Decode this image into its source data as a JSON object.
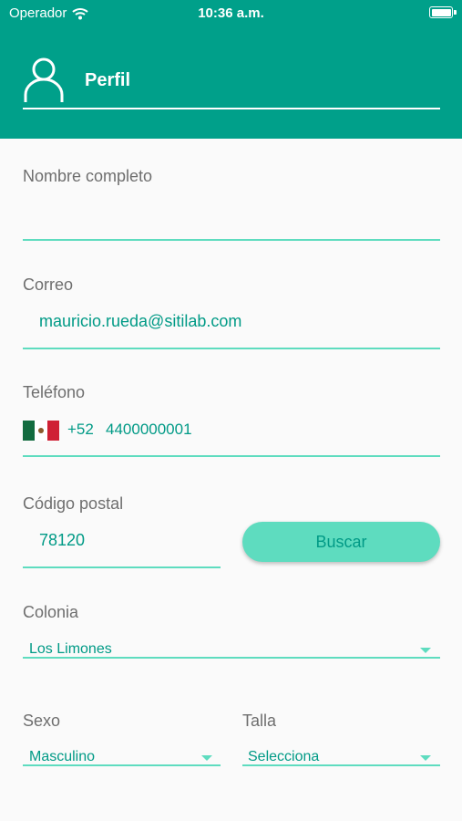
{
  "status_bar": {
    "carrier": "Operador",
    "time": "10:36 a.m."
  },
  "header": {
    "title": "Perfil",
    "icon": "user-icon"
  },
  "form": {
    "nombre": {
      "label": "Nombre completo",
      "value": ""
    },
    "correo": {
      "label": "Correo",
      "value": "mauricio.rueda@sitilab.com"
    },
    "telefono": {
      "label": "Teléfono",
      "country_code": "+52",
      "number": "4400000001",
      "flag_icon": "mexico-flag-icon"
    },
    "codigo_postal": {
      "label": "Código postal",
      "value": "78120",
      "button_label": "Buscar"
    },
    "colonia": {
      "label": "Colonia",
      "value": "Los Limones"
    },
    "sexo": {
      "label": "Sexo",
      "value": "Masculino"
    },
    "talla": {
      "label": "Talla",
      "value": "Selecciona"
    }
  },
  "colors": {
    "header_bg": "#00a08a",
    "accent": "#5edcbf",
    "value_text": "#009a86",
    "label_text": "#6e6e6e"
  }
}
